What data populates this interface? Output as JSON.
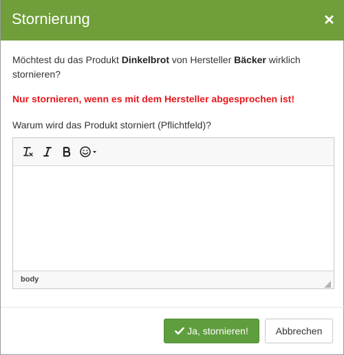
{
  "dialog": {
    "title": "Stornierung",
    "close_icon": "close-icon"
  },
  "message": {
    "prefix": "Möchtest du das Produkt ",
    "product": "Dinkelbrot",
    "middle": " von Hersteller ",
    "manufacturer": "Bäcker",
    "suffix": " wirklich stornieren?"
  },
  "warning": "Nur stornieren, wenn es mit dem Hersteller abgesprochen ist!",
  "reason_label": "Warum wird das Produkt storniert (Pflichtfeld)?",
  "editor": {
    "toolbar": [
      "clear-formatting-icon",
      "italic-icon",
      "bold-icon",
      "emoticon-icon"
    ],
    "content": "",
    "status_path": "body"
  },
  "buttons": {
    "confirm_label": "Ja, stornieren!",
    "cancel_label": "Abbrechen"
  },
  "colors": {
    "header": "#6f9e3a",
    "warning": "#e8161c",
    "primary_button": "#5f9e3e"
  }
}
